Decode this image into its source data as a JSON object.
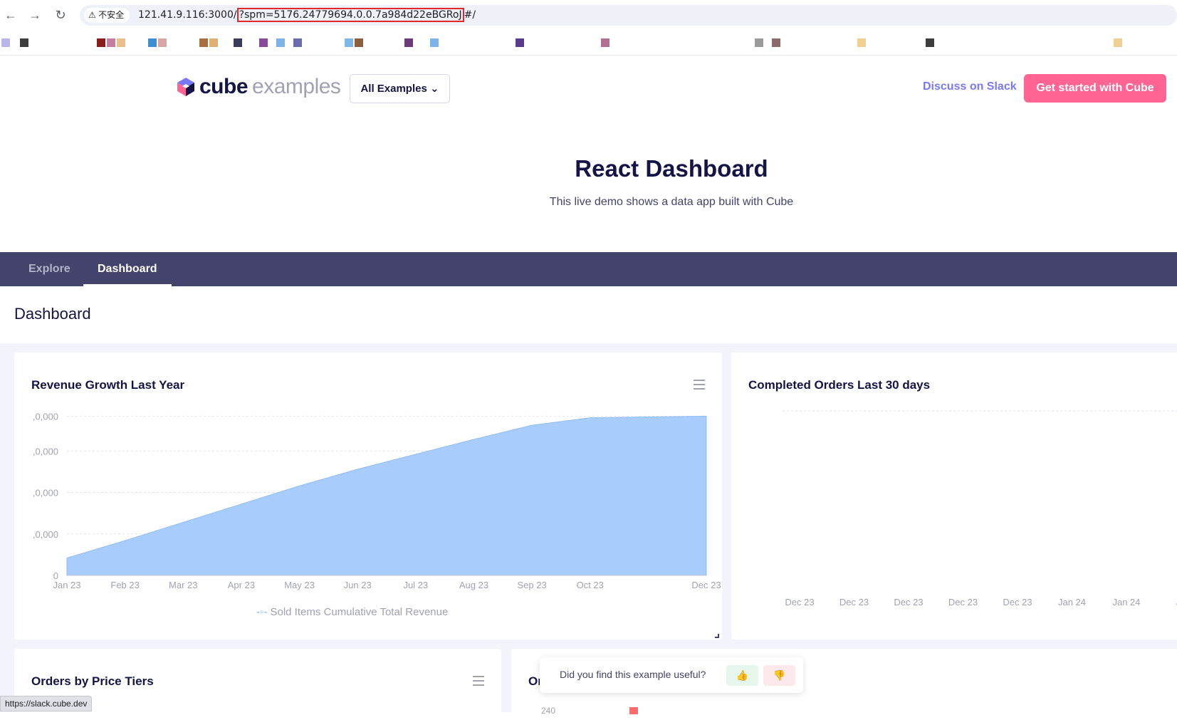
{
  "browser": {
    "back": "←",
    "forward": "→",
    "reload": "↻",
    "insecure_label": "⚠ 不安全",
    "url_prefix": "121.41.9.116:3000/",
    "url_highlight": "?spm=5176.24779694.0.0.7a984d22eBGRoJ",
    "url_suffix": "#/",
    "status_url": "https://slack.cube.dev"
  },
  "header": {
    "logo_primary": "cube",
    "logo_secondary": "examples",
    "examples_label": "All Examples ⌄",
    "slack_label": "Discuss on Slack",
    "cta_label": "Get started with Cube"
  },
  "hero": {
    "title": "React Dashboard",
    "subtitle": "This live demo shows a data app built with Cube"
  },
  "tabs": [
    {
      "label": "Explore",
      "active": false
    },
    {
      "label": "Dashboard",
      "active": true
    }
  ],
  "page": {
    "title": "Dashboard"
  },
  "cards": {
    "revenue": {
      "title": "Revenue Growth Last Year",
      "legend": "Sold Items Cumulative Total Revenue"
    },
    "orders": {
      "title": "Completed Orders Last 30 days"
    },
    "price_tiers": {
      "title": "Orders by Price Tiers"
    },
    "fourth": {
      "title": "Or",
      "partial_tick": "240"
    }
  },
  "chart_data": [
    {
      "type": "area",
      "title": "Revenue Growth Last Year",
      "categories": [
        "Jan 23",
        "Feb 23",
        "Mar 23",
        "Apr 23",
        "May 23",
        "Jun 23",
        "Jul 23",
        "Aug 23",
        "Sep 23",
        "Oct 23",
        "Dec 23"
      ],
      "y_tick_labels": [
        ",0,000",
        ",0,000",
        ",0,000",
        ",0,000",
        "0"
      ],
      "series": [
        {
          "name": "Sold Items Cumulative Total Revenue",
          "values": [
            10.5,
            21,
            32,
            43,
            54,
            64,
            73,
            82,
            90.5,
            95,
            96
          ]
        }
      ],
      "ylim": [
        0,
        100
      ],
      "grid": true,
      "legend": "bottom",
      "color": "#a8cdfd"
    },
    {
      "type": "line",
      "title": "Completed Orders Last 30 days",
      "categories": [
        "Dec 23",
        "Dec 23",
        "Dec 23",
        "Dec 23",
        "Dec 23",
        "Jan 24",
        "Jan 24",
        "Ja"
      ],
      "series": [],
      "grid": true
    }
  ],
  "feedback": {
    "question": "Did you find this example useful?",
    "yes_icon": "thumbs-up-icon",
    "no_icon": "thumbs-down-icon",
    "yes_glyph": "👍",
    "no_glyph": "👎"
  },
  "colors": {
    "accent": "#ff6492",
    "nav_bg": "#43436b",
    "link": "#7a77ff",
    "area": "#a8cdfd"
  }
}
